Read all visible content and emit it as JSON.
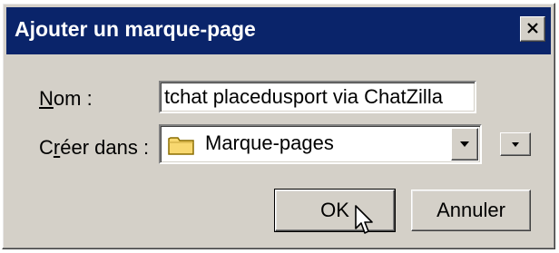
{
  "window": {
    "title": "Ajouter un marque-page",
    "close_icon": "close-icon"
  },
  "form": {
    "name_label_accesskey": "N",
    "name_label_rest": "om :",
    "name_value": "tchat placedusport via ChatZilla",
    "create_label_prefix": "C",
    "create_label_accesskey": "r",
    "create_label_rest": "éer dans :",
    "folder_value": "Marque-pages",
    "folder_icon": "folder-icon",
    "dropdown_icon": "chevron-down-icon",
    "expand_icon": "chevron-down-icon"
  },
  "buttons": {
    "ok_label": "OK",
    "cancel_label": "Annuler"
  },
  "colors": {
    "titlebar": "#0a246a",
    "face": "#d4d0c8",
    "folder": "#f8d870"
  }
}
